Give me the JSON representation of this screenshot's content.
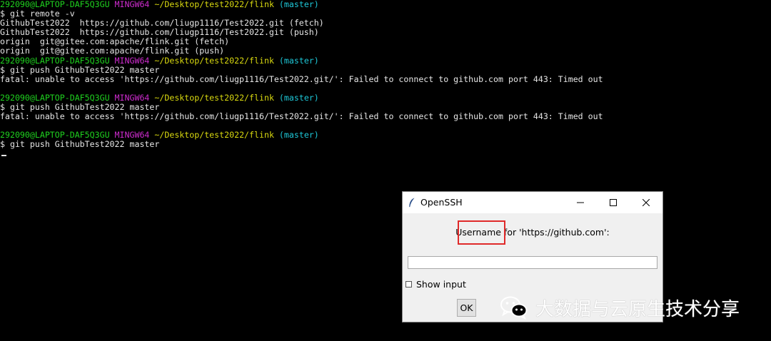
{
  "terminal": {
    "lines": [
      {
        "user": "292090@LAPTOP-DAF5Q3GU",
        "shell": "MINGW64",
        "path": "~/Desktop/test2022/flink",
        "branch": "(master)"
      },
      {
        "text": "$ git remote -v"
      },
      {
        "text": "GithubTest2022  https://github.com/liugp1116/Test2022.git (fetch)"
      },
      {
        "text": "GithubTest2022  https://github.com/liugp1116/Test2022.git (push)"
      },
      {
        "text": "origin  git@gitee.com:apache/flink.git (fetch)"
      },
      {
        "text": "origin  git@gitee.com:apache/flink.git (push)"
      },
      {
        "user": "292090@LAPTOP-DAF5Q3GU",
        "shell": "MINGW64",
        "path": "~/Desktop/test2022/flink",
        "branch": "(master)"
      },
      {
        "text": "$ git push GithubTest2022 master"
      },
      {
        "text": "fatal: unable to access 'https://github.com/liugp1116/Test2022.git/': Failed to connect to github.com port 443: Timed out"
      },
      {
        "text": ""
      },
      {
        "user": "292090@LAPTOP-DAF5Q3GU",
        "shell": "MINGW64",
        "path": "~/Desktop/test2022/flink",
        "branch": "(master)"
      },
      {
        "text": "$ git push GithubTest2022 master"
      },
      {
        "text": "fatal: unable to access 'https://github.com/liugp1116/Test2022.git/': Failed to connect to github.com port 443: Timed out"
      },
      {
        "text": ""
      },
      {
        "user": "292090@LAPTOP-DAF5Q3GU",
        "shell": "MINGW64",
        "path": "~/Desktop/test2022/flink",
        "branch": "(master)"
      },
      {
        "text": "$ git push GithubTest2022 master"
      }
    ]
  },
  "dialog": {
    "title": "OpenSSH",
    "prompt": "Username for 'https://github.com':",
    "entry_value": "",
    "show_input_label": "Show input",
    "show_input_checked": false,
    "ok_label": "OK",
    "icons": {
      "app": "feather-icon",
      "minimize": "minimize-icon",
      "maximize": "maximize-icon",
      "close": "close-icon"
    }
  },
  "watermark": {
    "text": "大数据与云原生技术分享",
    "icon": "wechat-icon"
  },
  "colors": {
    "prompt_user": "#1fd21f",
    "prompt_shell": "#cc2bcc",
    "prompt_path": "#d8d80f",
    "prompt_branch": "#1ec8d8",
    "highlight_box": "#e02a2a"
  }
}
